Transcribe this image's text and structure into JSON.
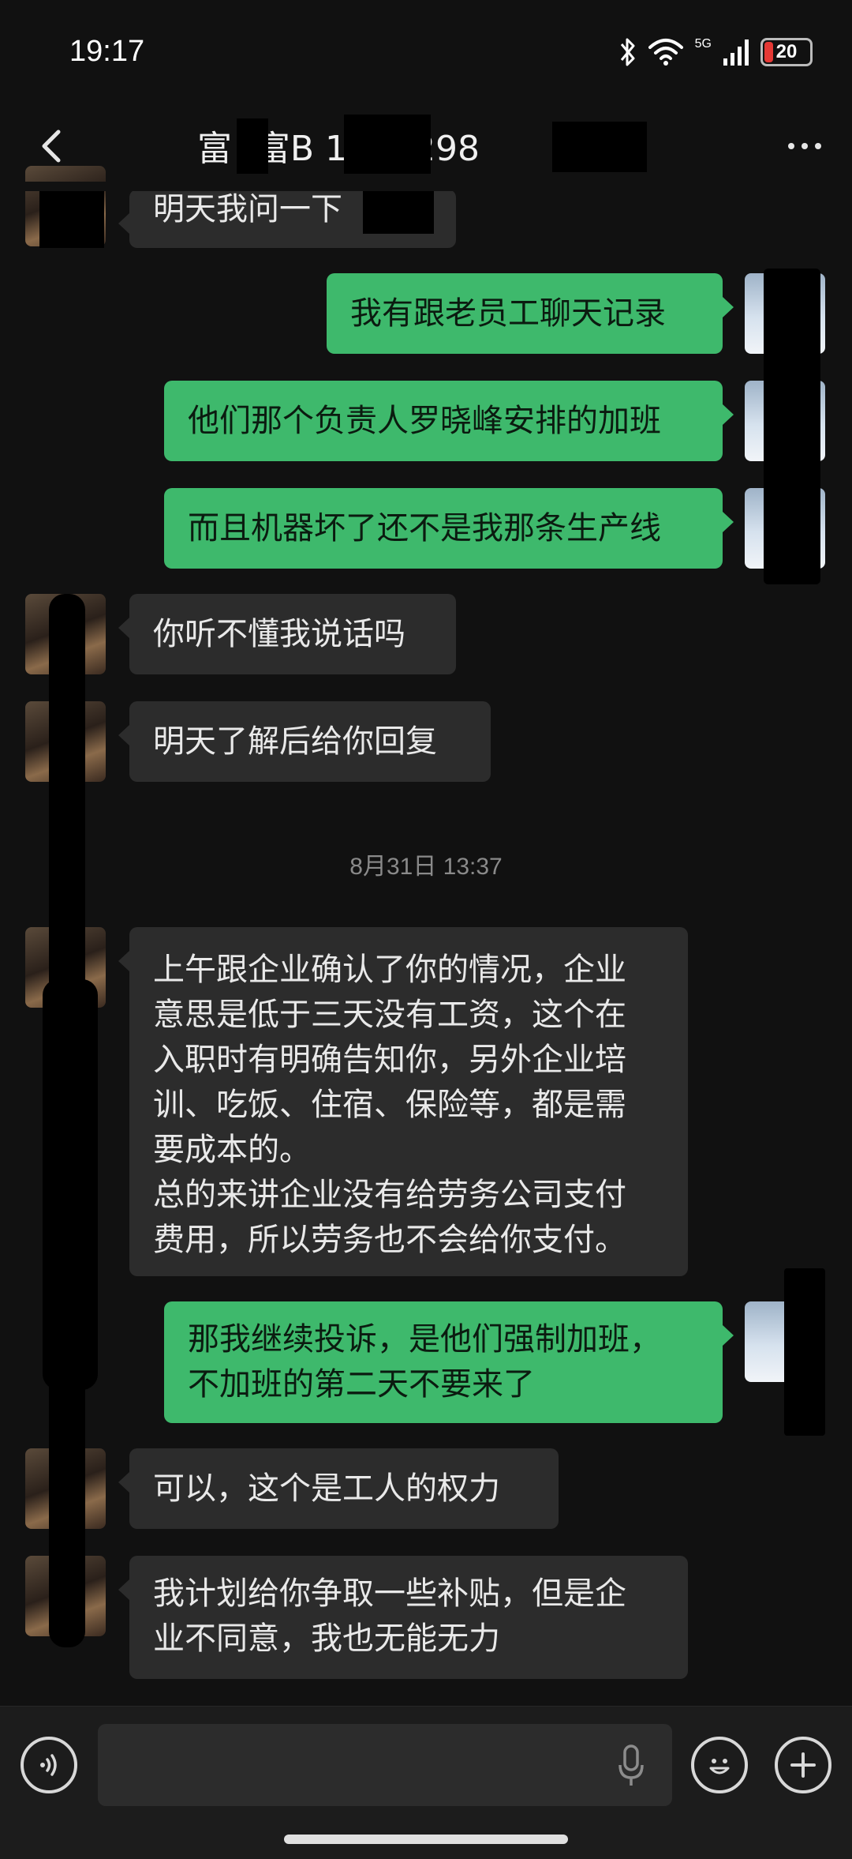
{
  "status_bar": {
    "time": "19:17",
    "network": "5G",
    "battery": "20",
    "battery_level": 0.2
  },
  "header": {
    "title": "富  -富B      1885298"
  },
  "messages": [
    {
      "side": "in",
      "text": "明天我问一下"
    },
    {
      "side": "out",
      "text": "我有跟老员工聊天记录"
    },
    {
      "side": "out",
      "text": "他们那个负责人罗晓峰安排的加班"
    },
    {
      "side": "out",
      "text": "而且机器坏了还不是我那条生产线"
    },
    {
      "side": "in",
      "text": "你听不懂我说话吗"
    },
    {
      "side": "in",
      "text": "明天了解后给你回复"
    },
    {
      "side": "in",
      "text": "上午跟企业确认了你的情况，企业\n意思是低于三天没有工资，这个在\n入职时有明确告知你，另外企业培\n训、吃饭、住宿、保险等，都是需\n要成本的。\n总的来讲企业没有给劳务公司支付\n费用，所以劳务也不会给你支付。"
    },
    {
      "side": "out",
      "text": "那我继续投诉，是他们强制加班，\n不加班的第二天不要来了"
    },
    {
      "side": "in",
      "text": "可以，这个是工人的权力"
    },
    {
      "side": "in",
      "text": "我计划给你争取一些补贴，但是企\n业不同意，我也无能无力"
    }
  ],
  "timestamp": "8月31日 13:37",
  "colors": {
    "background": "#111111",
    "incoming_bubble": "#2c2c2c",
    "outgoing_bubble": "#3eb96c",
    "redaction": "#000000"
  },
  "icons": {
    "back": "chevron-left-icon",
    "more": "more-dots-icon",
    "voice": "voice-icon",
    "mic": "mic-icon",
    "emoji": "emoji-icon",
    "plus": "plus-icon"
  }
}
